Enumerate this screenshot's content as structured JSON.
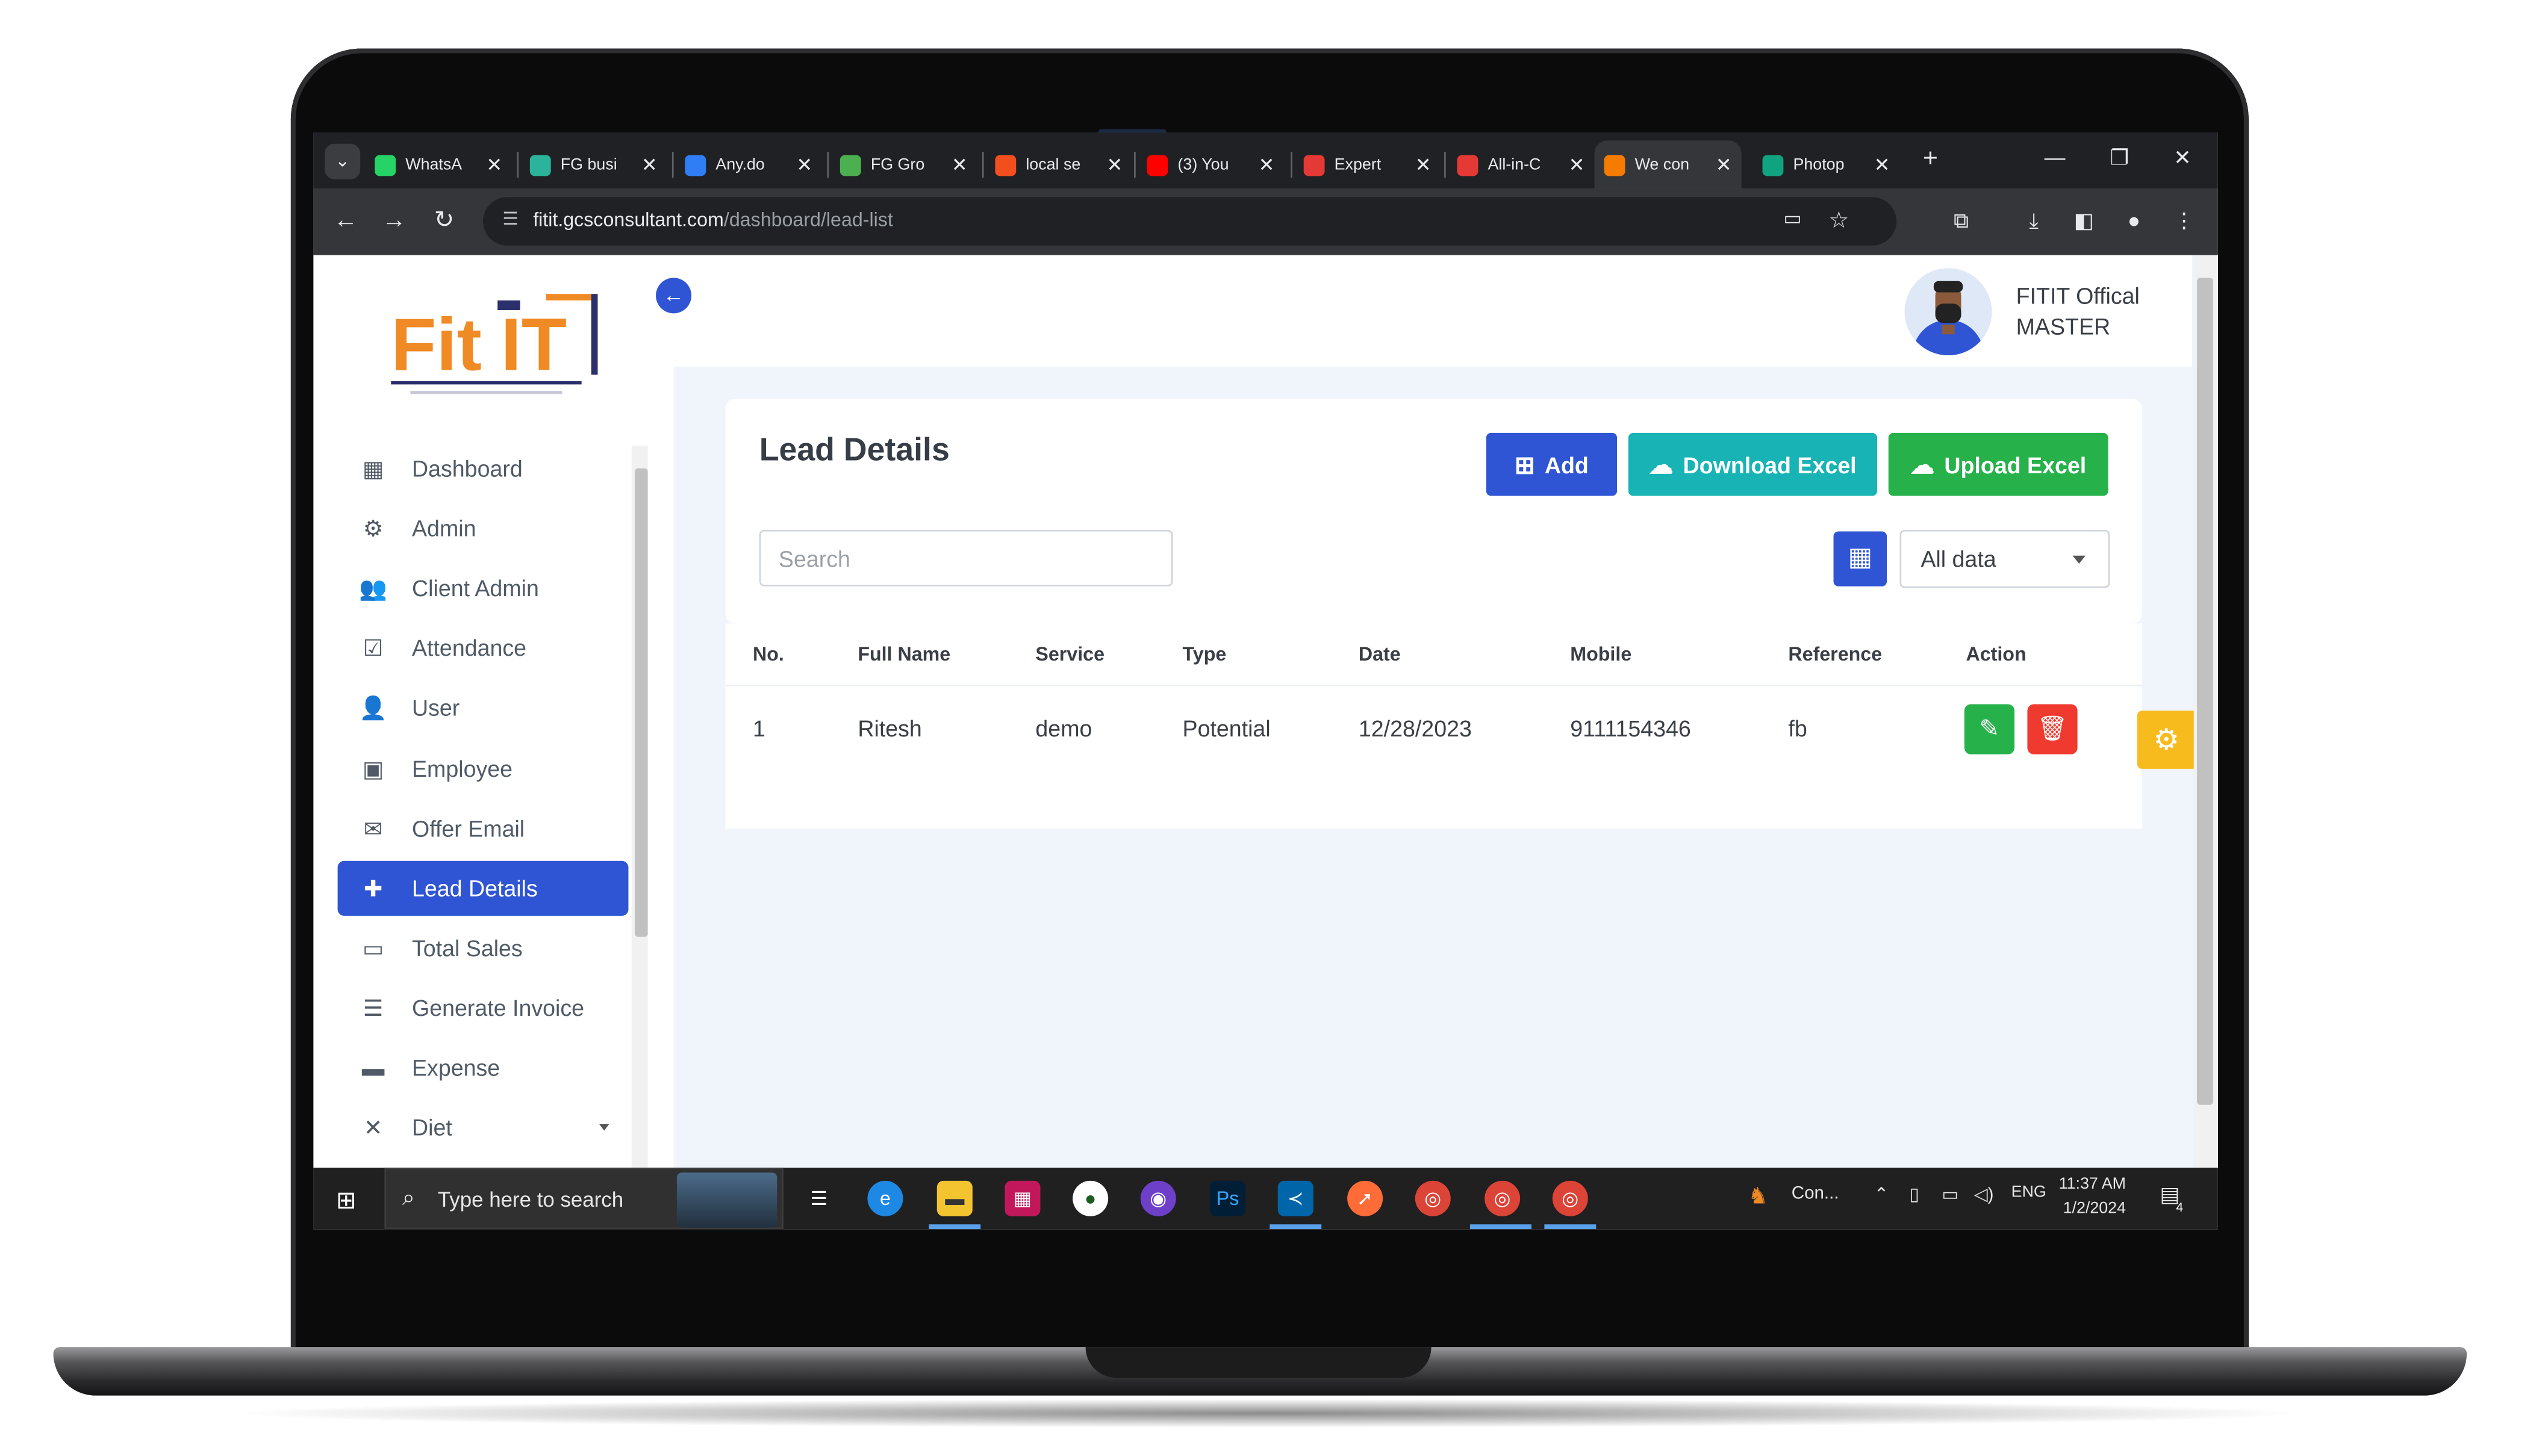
{
  "browser": {
    "tabs": [
      {
        "title": "WhatsA",
        "color": "#25d366",
        "active": false
      },
      {
        "title": "FG busi",
        "color": "#2bb39b",
        "active": false
      },
      {
        "title": "Any.do",
        "color": "#2f7ef5",
        "active": false
      },
      {
        "title": "FG Gro",
        "color": "#4caf50",
        "active": false
      },
      {
        "title": "local se",
        "color": "#f24e1e",
        "active": false
      },
      {
        "title": "(3) You",
        "color": "#ff0000",
        "active": false
      },
      {
        "title": "Expert",
        "color": "#e53935",
        "active": false
      },
      {
        "title": "All-in-C",
        "color": "#e53935",
        "active": false
      },
      {
        "title": "We con",
        "color": "#f57c00",
        "active": true
      },
      {
        "title": "Photop",
        "color": "#10a37f",
        "active": false
      }
    ],
    "url_host": "fitit.gcsconsultant.com",
    "url_path": "/dashboard/lead-list"
  },
  "sidebar": {
    "items": [
      {
        "label": "Dashboard",
        "icon": "dashboard-icon",
        "glyph": "▦",
        "active": false
      },
      {
        "label": "Admin",
        "icon": "admin-icon",
        "glyph": "⚙",
        "active": false
      },
      {
        "label": "Client Admin",
        "icon": "users-icon",
        "glyph": "👥",
        "active": false
      },
      {
        "label": "Attendance",
        "icon": "calendar-check-icon",
        "glyph": "☑",
        "active": false
      },
      {
        "label": "User",
        "icon": "user-add-icon",
        "glyph": "👤",
        "active": false
      },
      {
        "label": "Employee",
        "icon": "badge-icon",
        "glyph": "▣",
        "active": false
      },
      {
        "label": "Offer Email",
        "icon": "mail-icon",
        "glyph": "✉",
        "active": false
      },
      {
        "label": "Lead Details",
        "icon": "document-add-icon",
        "glyph": "✚",
        "active": true
      },
      {
        "label": "Total Sales",
        "icon": "card-icon",
        "glyph": "▭",
        "active": false
      },
      {
        "label": "Generate Invoice",
        "icon": "invoice-icon",
        "glyph": "☰",
        "active": false
      },
      {
        "label": "Expense",
        "icon": "wallet-icon",
        "glyph": "▬",
        "active": false
      },
      {
        "label": "Diet",
        "icon": "utensils-icon",
        "glyph": "✕",
        "active": false
      }
    ]
  },
  "header": {
    "user_name": "FITIT Offical",
    "user_role": "MASTER"
  },
  "main": {
    "title": "Lead Details",
    "buttons": {
      "add": "Add",
      "download": "Download Excel",
      "upload": "Upload Excel"
    },
    "search_placeholder": "Search",
    "filter_value": "All data",
    "columns": [
      "No.",
      "Full Name",
      "Service",
      "Type",
      "Date",
      "Mobile",
      "Reference",
      "Action"
    ],
    "rows": [
      {
        "no": "1",
        "full_name": "Ritesh",
        "service": "demo",
        "type": "Potential",
        "date": "12/28/2023",
        "mobile": "9111154346",
        "reference": "fb"
      }
    ]
  },
  "taskbar": {
    "search_text": "Type here to search",
    "tray_app": "Con...",
    "language": "ENG",
    "time": "11:37 AM",
    "date": "1/2/2024",
    "notifications": "4"
  },
  "colors": {
    "primary": "#2f55d4",
    "teal": "#17b3b5",
    "green": "#26b14a",
    "red": "#f0392f",
    "logo_orange": "#f08a24"
  }
}
